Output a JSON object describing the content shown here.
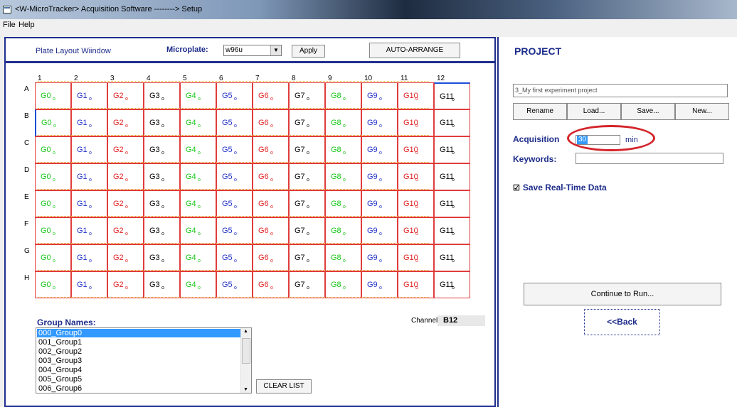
{
  "window": {
    "title": "<W-MicroTracker> Acquisition Software --------> Setup"
  },
  "menu": [
    "File",
    "Help"
  ],
  "plate": {
    "window_title": "Plate Layout Wiindow",
    "microplate_label": "Microplate:",
    "microplate_value": "w96u",
    "apply_label": "Apply",
    "auto_arrange_label": "AUTO-ARRANGE",
    "rows": [
      "A",
      "B",
      "C",
      "D",
      "E",
      "F",
      "G",
      "H"
    ],
    "columns": [
      "1",
      "2",
      "3",
      "4",
      "5",
      "6",
      "7",
      "8",
      "9",
      "10",
      "11",
      "12"
    ],
    "groups": [
      "G0",
      "G1",
      "G2",
      "G3",
      "G4",
      "G5",
      "G6",
      "G7",
      "G8",
      "G9",
      "G10",
      "G11"
    ],
    "group_colors": [
      "#19c619",
      "#2030c8",
      "#e02020",
      "#000000",
      "#19c619",
      "#2030c8",
      "#e02020",
      "#000000",
      "#19c619",
      "#2030c8",
      "#e02020",
      "#000000"
    ],
    "dot_char": "o"
  },
  "groups_panel": {
    "title": "Group Names:",
    "items": [
      "000_Group0",
      "001_Group1",
      "002_Group2",
      "003_Group3",
      "004_Group4",
      "005_Group5",
      "006_Group6"
    ],
    "clear_label": "CLEAR LIST",
    "channel_label": "Channel:",
    "channel_value": "B12"
  },
  "project": {
    "title": "PROJECT",
    "name": "3_My first experiment project",
    "buttons": [
      "Rename",
      "Load...",
      "Save...",
      "New..."
    ],
    "acquisition_label": "Acquisition",
    "acquisition_value": "30",
    "acquisition_unit": "min",
    "keywords_label": "Keywords:",
    "keywords_value": "",
    "save_realtime_label": "Save Real-Time Data",
    "continue_label": "Continue to Run...",
    "back_label": "<<Back"
  }
}
